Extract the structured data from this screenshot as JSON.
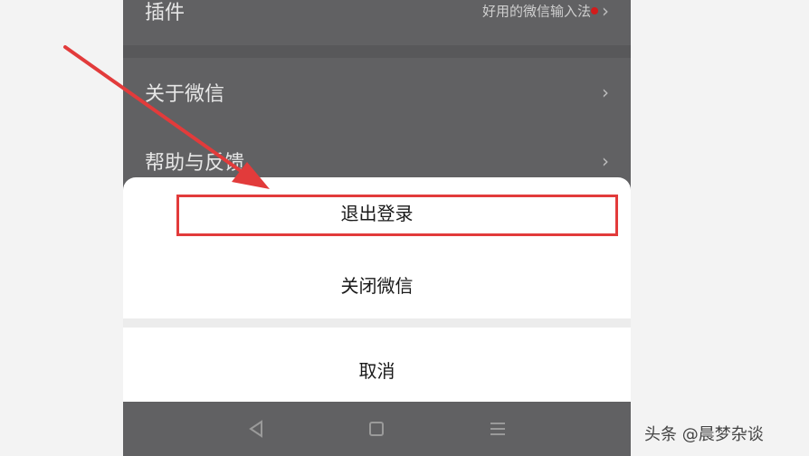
{
  "settings": {
    "plugins": {
      "label": "插件",
      "value": "好用的微信输入法"
    },
    "about": {
      "label": "关于微信"
    },
    "help": {
      "label": "帮助与反馈"
    }
  },
  "action_sheet": {
    "logout_label": "退出登录",
    "close_label": "关闭微信",
    "cancel_label": "取消"
  },
  "nav_icons": [
    "back-triangle-icon",
    "home-square-icon",
    "menu-lines-icon"
  ],
  "annotation": {
    "color": "#e23b3b"
  },
  "watermark": {
    "text": "头条 @晨梦杂谈"
  }
}
